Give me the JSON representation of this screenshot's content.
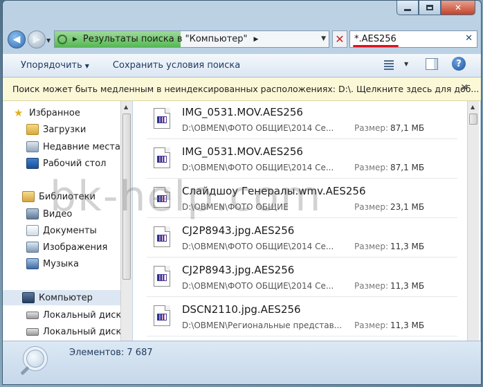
{
  "window": {
    "controls": {
      "minimize_icon": "minimize-icon",
      "maximize_icon": "maximize-icon",
      "close_icon": "close-icon"
    }
  },
  "navigation": {
    "back_icon": "back-arrow-icon",
    "forward_icon": "forward-arrow-icon",
    "address": "Результаты поиска в \"Компьютер\"",
    "refresh_stop_icon": "stop-icon"
  },
  "search": {
    "query": "*.AES256",
    "clear_icon": "clear-icon"
  },
  "toolbar": {
    "organize_label": "Упорядочить",
    "save_search_label": "Сохранить условия поиска"
  },
  "info_bar": {
    "message": "Поиск может быть медленным в неиндексированных расположениях: D:\\. Щелкните здесь для доб..."
  },
  "sidebar": {
    "favorites": {
      "label": "Избранное",
      "items": [
        {
          "label": "Загрузки"
        },
        {
          "label": "Недавние места"
        },
        {
          "label": "Рабочий стол"
        }
      ]
    },
    "libraries": {
      "label": "Библиотеки",
      "items": [
        {
          "label": "Видео"
        },
        {
          "label": "Документы"
        },
        {
          "label": "Изображения"
        },
        {
          "label": "Музыка"
        }
      ]
    },
    "computer": {
      "label": "Компьютер",
      "items": [
        {
          "label": "Локальный диск ("
        },
        {
          "label": "Локальный диск ("
        }
      ]
    }
  },
  "results": {
    "size_label": "Размер:",
    "files": [
      {
        "name": "IMG_0531.MOV.AES256",
        "path": "D:\\OBMEN\\ФОТО ОБЩИЕ\\2014 Се...",
        "size": "87,1 МБ"
      },
      {
        "name": "IMG_0531.MOV.AES256",
        "path": "D:\\OBMEN\\ФОТО ОБЩИЕ\\2014 Се...",
        "size": "87,1 МБ"
      },
      {
        "name": "Слайдшоу Генералы.wmv.AES256",
        "path": "D:\\OBMEN\\ФОТО ОБЩИЕ",
        "size": "23,1 МБ"
      },
      {
        "name": "CJ2P8943.jpg.AES256",
        "path": "D:\\OBMEN\\ФОТО ОБЩИЕ\\2014 Се...",
        "size": "11,3 МБ"
      },
      {
        "name": "CJ2P8943.jpg.AES256",
        "path": "D:\\OBMEN\\ФОТО ОБЩИЕ\\2014 Се...",
        "size": "11,3 МБ"
      },
      {
        "name": "DSCN2110.jpg.AES256",
        "path": "D:\\OBMEN\\Региональные представ...",
        "size": "11,3 МБ"
      }
    ]
  },
  "status_bar": {
    "items_count": "Элементов: 7 687"
  },
  "watermark": "bk-help.com"
}
